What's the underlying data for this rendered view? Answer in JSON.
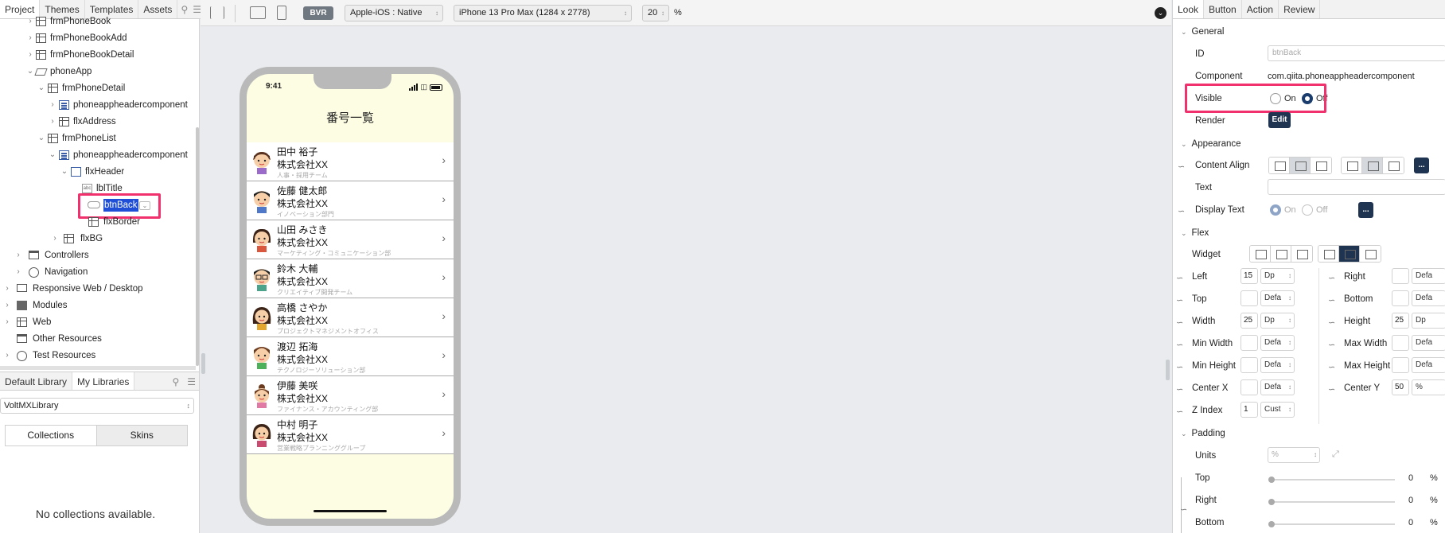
{
  "left": {
    "tabs": [
      "Project",
      "Themes",
      "Templates",
      "Assets"
    ],
    "tree": [
      {
        "label": "frmPhoneBook",
        "icon": "form-icon"
      },
      {
        "label": "frmPhoneBookAdd",
        "icon": "form-icon"
      },
      {
        "label": "frmPhoneBookDetail",
        "icon": "form-icon"
      },
      {
        "label": "phoneApp",
        "icon": "layers-icon"
      },
      {
        "label": "frmPhoneDetail",
        "icon": "form-icon"
      },
      {
        "label": "phoneappheadercomponent",
        "icon": "component-icon"
      },
      {
        "label": "flxAddress",
        "icon": "flex-icon"
      },
      {
        "label": "frmPhoneList",
        "icon": "form-icon"
      },
      {
        "label": "phoneappheadercomponent",
        "icon": "component-icon"
      },
      {
        "label": "flxHeader",
        "icon": "flex-icon"
      },
      {
        "label": "lblTitle",
        "icon": "label-icon"
      },
      {
        "label": "btnBack",
        "icon": "button-icon",
        "selected": true
      },
      {
        "label": "flxBorder",
        "icon": "flex-icon"
      },
      {
        "label": "flxBG",
        "icon": "flex-icon"
      },
      {
        "label": "Controllers",
        "icon": "folder-icon"
      },
      {
        "label": "Navigation",
        "icon": "compass-icon"
      },
      {
        "label": "Responsive Web / Desktop",
        "icon": "monitor-icon"
      },
      {
        "label": "Modules",
        "icon": "module-icon"
      },
      {
        "label": "Web",
        "icon": "grid-icon"
      },
      {
        "label": "Other Resources",
        "icon": "folder-icon"
      },
      {
        "label": "Test Resources",
        "icon": "gauge-icon"
      }
    ],
    "lib_tabs": [
      "Default Library",
      "My Libraries"
    ],
    "library_select": "VoltMXLibrary",
    "collections_label": "Collections",
    "skins_label": "Skins",
    "empty_text": "No collections available."
  },
  "toolbar": {
    "bvr_label": "BVR",
    "platform": "Apple-iOS : Native",
    "device": "iPhone 13 Pro Max (1284 x 2778)",
    "zoom": "20",
    "zoom_unit": "%"
  },
  "phone": {
    "time": "9:41",
    "title": "番号一覧",
    "contacts": [
      {
        "name": "田中 裕子",
        "company": "株式会社XX",
        "dept": "人事・採用チーム"
      },
      {
        "name": "佐藤 健太郎",
        "company": "株式会社XX",
        "dept": "イノベーション部門"
      },
      {
        "name": "山田 みさき",
        "company": "株式会社XX",
        "dept": "マーケティング・コミュニケーション部"
      },
      {
        "name": "鈴木 大輔",
        "company": "株式会社XX",
        "dept": "クリエイティブ開発チーム"
      },
      {
        "name": "高橋 さやか",
        "company": "株式会社XX",
        "dept": "プロジェクトマネジメントオフィス"
      },
      {
        "name": "渡辺 拓海",
        "company": "株式会社XX",
        "dept": "テクノロジーソリューション部"
      },
      {
        "name": "伊藤 美咲",
        "company": "株式会社XX",
        "dept": "ファイナンス・アカウンティング部"
      },
      {
        "name": "中村 明子",
        "company": "株式会社XX",
        "dept": "営業戦略プランニンググループ"
      }
    ]
  },
  "right": {
    "tabs": [
      "Look",
      "Button",
      "Action",
      "Review"
    ],
    "general": {
      "title": "General",
      "id_label": "ID",
      "id_value": "btnBack",
      "component_label": "Component",
      "component_value": "com.qiita.phoneappheadercomponent",
      "visible_label": "Visible",
      "on_label": "On",
      "off_label": "Off",
      "render_label": "Render",
      "edit_label": "Edit"
    },
    "appearance": {
      "title": "Appearance",
      "content_align_label": "Content Align",
      "text_label": "Text",
      "display_text_label": "Display Text",
      "on_label": "On",
      "off_label": "Off",
      "more_label": "..."
    },
    "flex": {
      "title": "Flex",
      "widget_label": "Widget",
      "rows": [
        {
          "l_label": "Left",
          "l_val": "15",
          "l_unit": "Dp",
          "r_label": "Right",
          "r_val": "",
          "r_unit": "Defa"
        },
        {
          "l_label": "Top",
          "l_val": "",
          "l_unit": "Defa",
          "r_label": "Bottom",
          "r_val": "",
          "r_unit": "Defa"
        },
        {
          "l_label": "Width",
          "l_val": "25",
          "l_unit": "Dp",
          "r_label": "Height",
          "r_val": "25",
          "r_unit": "Dp"
        },
        {
          "l_label": "Min Width",
          "l_val": "",
          "l_unit": "Defa",
          "r_label": "Max Width",
          "r_val": "",
          "r_unit": "Defa"
        },
        {
          "l_label": "Min Height",
          "l_val": "",
          "l_unit": "Defa",
          "r_label": "Max Height",
          "r_val": "",
          "r_unit": "Defa"
        },
        {
          "l_label": "Center X",
          "l_val": "",
          "l_unit": "Defa",
          "r_label": "Center Y",
          "r_val": "50",
          "r_unit": "%"
        },
        {
          "l_label": "Z Index",
          "l_val": "1",
          "l_unit": "Cust"
        }
      ]
    },
    "padding": {
      "title": "Padding",
      "units_label": "Units",
      "units_value": "%",
      "rows": [
        {
          "label": "Top",
          "value": "0",
          "unit": "%"
        },
        {
          "label": "Right",
          "value": "0",
          "unit": "%"
        },
        {
          "label": "Bottom",
          "value": "0",
          "unit": "%"
        }
      ]
    }
  },
  "colors": {
    "highlight": "#f1316e",
    "selection": "#1e4fd6",
    "dark_button": "#1f3451",
    "phone_bg": "#fdfde4"
  }
}
